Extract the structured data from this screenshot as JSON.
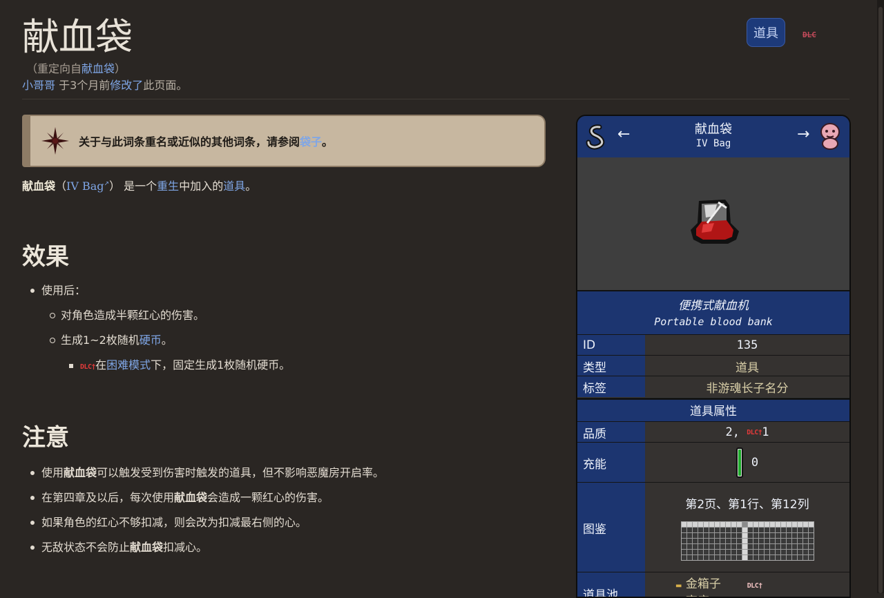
{
  "page": {
    "title": "献血袋",
    "redirect_prefix": "（重定向自",
    "redirect_link": "献血袋",
    "redirect_suffix": "）",
    "editor": "小哥哥",
    "edit_mid": " 于3个月前",
    "edit_link": "修改了",
    "edit_suffix": "此页面。",
    "tag_button": "道具",
    "dlc_badge": "DLC"
  },
  "notice": {
    "text": "关于与此词条重名或近似的其他词条，请参阅",
    "link": "袋子",
    "end": "。"
  },
  "intro": {
    "name": "献血袋",
    "open": "（",
    "en_link": "IV Bag",
    "close": "） 是一个",
    "link1": "重生",
    "mid": "中加入的",
    "link2": "道具",
    "end": "。"
  },
  "effects": {
    "heading": "效果",
    "item1": "使用后：",
    "item1a": "对角色造成半颗红心的伤害。",
    "item1b_pre": "生成1~2枚随机",
    "item1b_link": "硬币",
    "item1b_end": "。",
    "item1b_dlc": "DLC†",
    "item1b_sub_pre": "在",
    "item1b_sub_link": "困难模式",
    "item1b_sub_end": "下，固定生成1枚随机硬币。"
  },
  "notes": {
    "heading": "注意",
    "n1_pre": "使用",
    "n1_bold": "献血袋",
    "n1_end": "可以触发受到伤害时触发的道具，但不影响恶魔房开启率。",
    "n2_pre": "在第四章及以后，每次使用",
    "n2_bold": "献血袋",
    "n2_end": "会造成一颗红心的伤害。",
    "n3": "如果角色的红心不够扣减，则会改为扣减最右侧的心。",
    "n4_pre": "无敌状态不会防止",
    "n4_bold": "献血袋",
    "n4_end": "扣减心。"
  },
  "infobox": {
    "name": "献血袋",
    "name_en": "IV Bag",
    "prev_arrow": "←",
    "next_arrow": "→",
    "quote_zh": "便携式献血机",
    "quote_en": "Portable blood bank",
    "rows": {
      "id_label": "ID",
      "id_value": "135",
      "type_label": "类型",
      "type_value": "道具",
      "tag_label": "标签",
      "tag_value": "非游魂长子名分"
    },
    "section": "道具属性",
    "quality_label": "品质",
    "quality_value": "2,",
    "quality_dlc": "DLC†",
    "quality_dlc_value": "1",
    "charge_label": "充能",
    "charge_value": "0",
    "charge_fill": 1.0,
    "collection_label": "图鉴",
    "collection_value": "第2页、第1行、第12列",
    "collection_grid": {
      "rows": 7,
      "cols": 24,
      "highlight_row": 1,
      "highlight_col": 12
    },
    "pool_label": "道具池",
    "pool_1": "金箱子",
    "pool_dlc": "DLC†",
    "pool_2": "商店"
  },
  "colors": {
    "background": "#2a2623",
    "infobox_blue": "#1c3570",
    "link": "#7fa6e6",
    "notice_bg": "#c7b7a0",
    "dlc_red": "#e23a3a"
  }
}
